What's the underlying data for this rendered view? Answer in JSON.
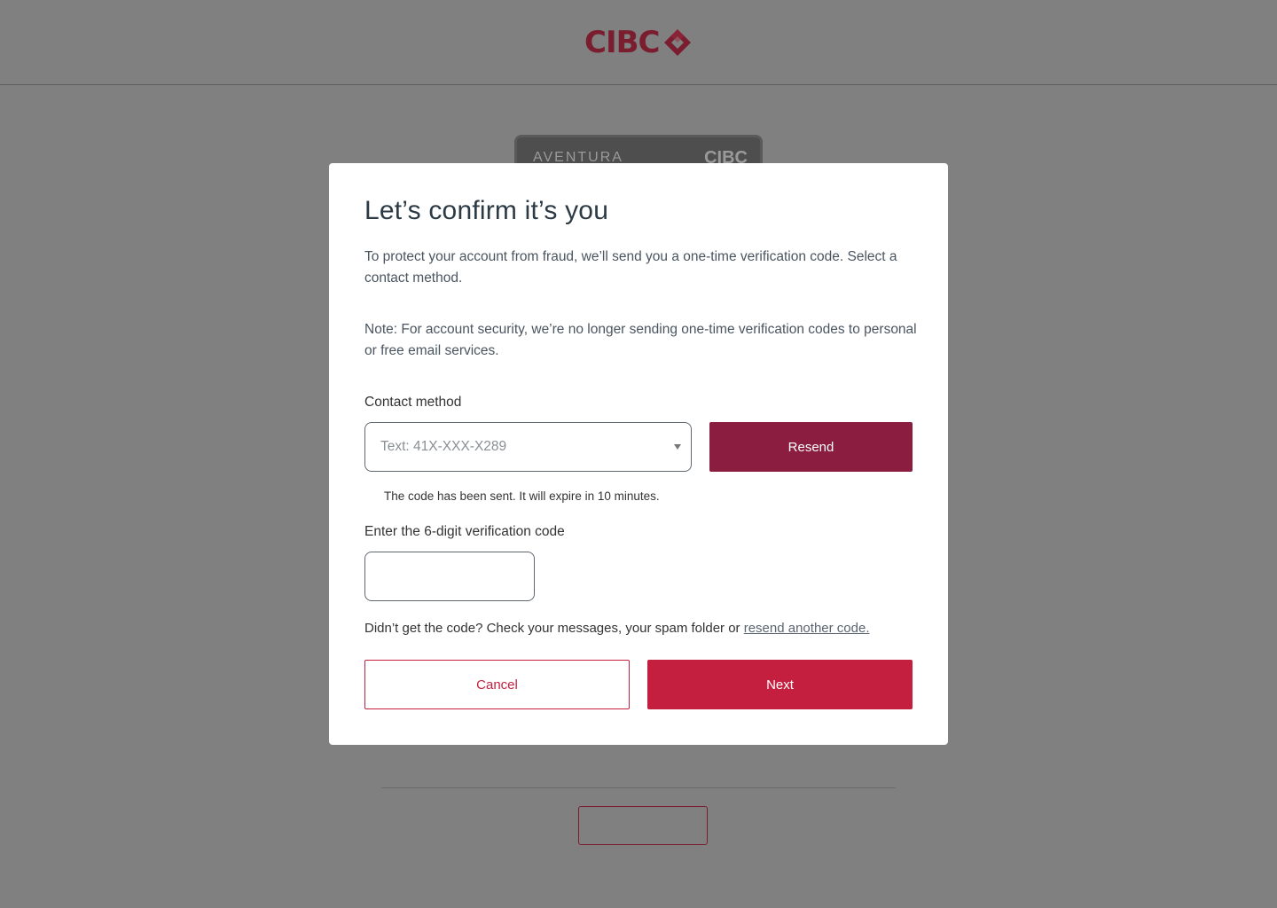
{
  "header": {
    "logo_text": "CIBC"
  },
  "background": {
    "card_name": "AVENTURA",
    "card_brand": "CIBC"
  },
  "modal": {
    "title": "Let’s confirm it’s you",
    "intro": "To protect your account from fraud, we’ll send you a one-time verification code. Select a contact method.",
    "note": "Note: For account security, we’re no longer sending one-time verification codes to personal or free email services.",
    "contact_label": "Contact method",
    "contact_selected": "Text: 41X-XXX-X289",
    "resend_label": "Resend",
    "sent_message": "The code has been sent. It will expire in 10 minutes.",
    "code_label": "Enter the 6-digit verification code",
    "code_value": "",
    "help_text": "Didn’t get the code? Check your messages, your spam folder or ",
    "help_link": "resend another code.",
    "cancel_label": "Cancel",
    "next_label": "Next"
  },
  "colors": {
    "brand": "#7a1d2f",
    "resend_button": "#8b1d40",
    "primary_button": "#c41f3e",
    "overlay": "#808080"
  }
}
